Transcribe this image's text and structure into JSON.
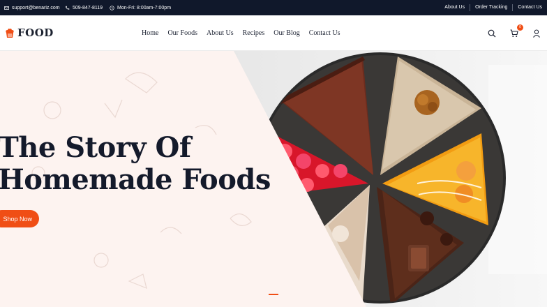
{
  "topbar": {
    "email": "support@benariz.com",
    "phone": "509-847-8119",
    "hours": "Mon-Fri: 8:00am-7:00pm",
    "links": [
      "About Us",
      "Order Tracking",
      "Contact Us"
    ]
  },
  "header": {
    "logo": "FOOD",
    "nav": [
      "Home",
      "Our Foods",
      "About Us",
      "Recipes",
      "Our Blog",
      "Contact Us"
    ],
    "cart_count": "0"
  },
  "hero": {
    "title_line1": "The Story Of",
    "title_line2": "Homemade Foods",
    "button": "Shop Now"
  },
  "colors": {
    "accent": "#f04e15",
    "dark": "#10182b",
    "hero_panel": "#fdf3f0"
  }
}
